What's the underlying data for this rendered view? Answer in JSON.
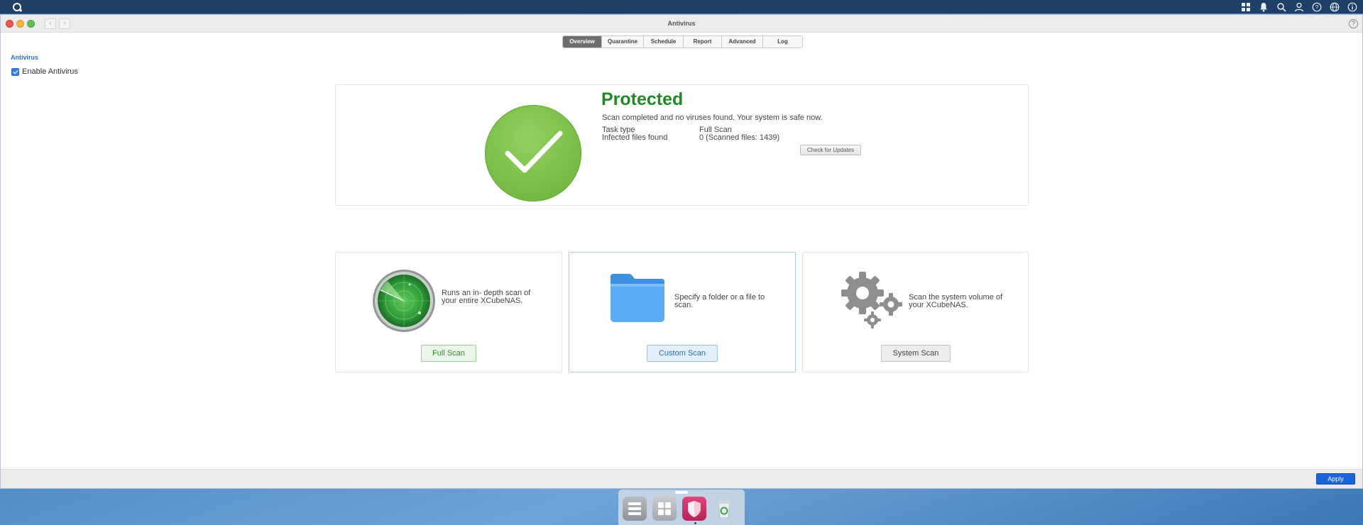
{
  "window": {
    "title": "Antivirus"
  },
  "tabs": [
    {
      "label": "Overview",
      "active": true
    },
    {
      "label": "Quarantine",
      "active": false
    },
    {
      "label": "Schedule",
      "active": false
    },
    {
      "label": "Report",
      "active": false
    },
    {
      "label": "Advanced",
      "active": false
    },
    {
      "label": "Log",
      "active": false
    }
  ],
  "section": {
    "title": "Antivirus"
  },
  "enable": {
    "label": "Enable Antivirus",
    "checked": true
  },
  "status": {
    "title": "Protected",
    "description": "Scan completed and no viruses found. Your system is safe now.",
    "task_type_label": "Task type",
    "task_type_value": "Full Scan",
    "infected_label": "Infected files found",
    "infected_value": "0 (Scanned files: 1439)",
    "check_updates_label": "Check for Updates",
    "color": "#1f8a25"
  },
  "cards": {
    "full": {
      "description": "Runs an in- depth scan of your entire XCubeNAS.",
      "button": "Full Scan",
      "icon": "radar-icon"
    },
    "custom": {
      "description": "Specify a folder or a file to scan.",
      "button": "Custom Scan",
      "icon": "folder-icon"
    },
    "system": {
      "description": "Scan the system volume of your XCubeNAS.",
      "button": "System Scan",
      "icon": "gears-icon"
    }
  },
  "footer": {
    "apply_label": "Apply"
  },
  "dock": {
    "items": [
      "storage-manager-icon",
      "app-grid-icon",
      "antivirus-shield-icon",
      "recycle-bin-icon"
    ]
  },
  "colors": {
    "topbar": "#1f3f66",
    "apply": "#1c64d6",
    "tab_active": "#6d6d6d"
  }
}
